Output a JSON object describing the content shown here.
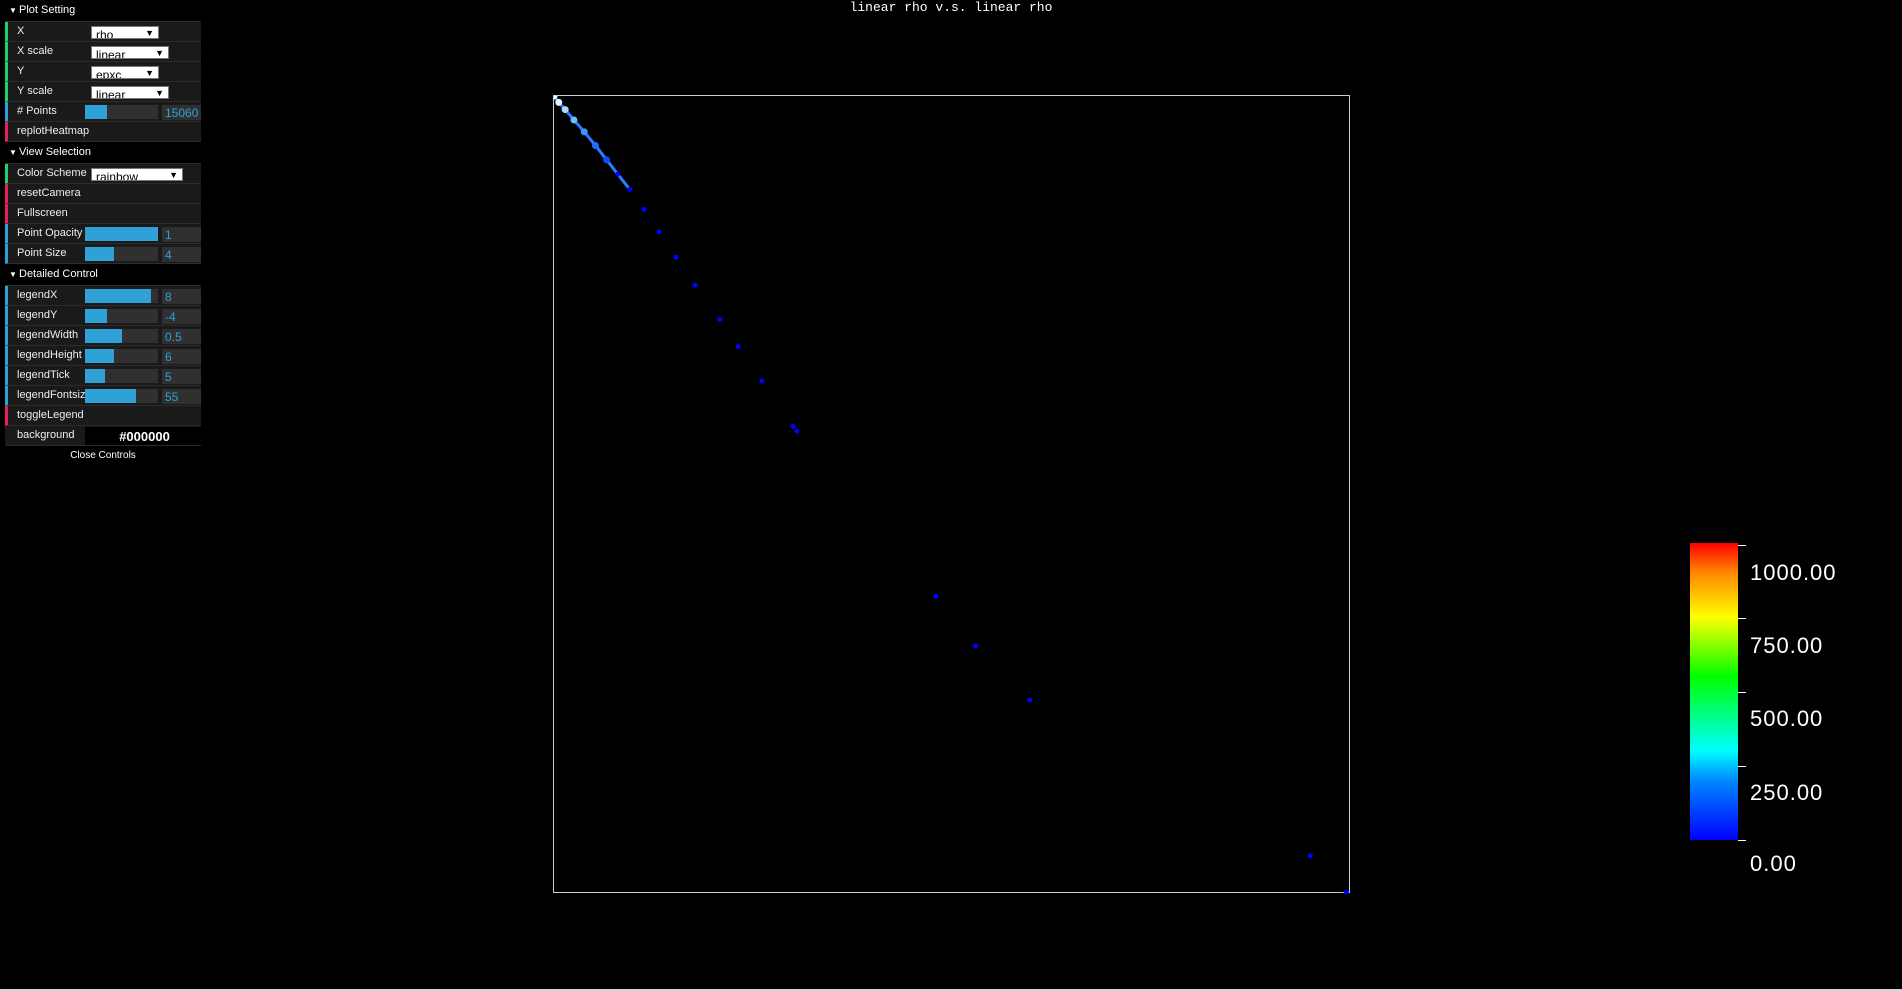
{
  "gui": {
    "plot_setting": {
      "title": "Plot Setting",
      "x_label": "X",
      "x_value": "rho",
      "x_scale_label": "X scale",
      "x_scale_value": "linear",
      "y_label": "Y",
      "y_value": "epxc",
      "y_scale_label": "Y scale",
      "y_scale_value": "linear",
      "points_label": "# Points",
      "points_value": "15060",
      "points_fill": 0.3,
      "replot_label": "replotHeatmap"
    },
    "view_selection": {
      "title": "View Selection",
      "color_scheme_label": "Color Scheme",
      "color_scheme_value": "rainbow",
      "reset_camera_label": "resetCamera",
      "fullscreen_label": "Fullscreen",
      "point_opacity_label": "Point Opacity",
      "point_opacity_value": "1",
      "point_opacity_fill": 1.0,
      "point_size_label": "Point Size",
      "point_size_value": "4",
      "point_size_fill": 0.4
    },
    "detailed_control": {
      "title": "Detailed Control",
      "legendx_label": "legendX",
      "legendx_value": "8",
      "legendx_fill": 0.9,
      "legendy_label": "legendY",
      "legendy_value": "-4",
      "legendy_fill": 0.3,
      "legendwidth_label": "legendWidth",
      "legendwidth_value": "0.5",
      "legendwidth_fill": 0.5,
      "legendheight_label": "legendHeight",
      "legendheight_value": "6",
      "legendheight_fill": 0.4,
      "legendtick_label": "legendTick",
      "legendtick_value": "5",
      "legendtick_fill": 0.28,
      "legendfontsize_label": "legendFontsize",
      "legendfontsize_value": "55",
      "legendfontsize_fill": 0.7,
      "togglelegend_label": "toggleLegend",
      "background_label": "background",
      "background_value": "#000000"
    },
    "close_label": "Close Controls"
  },
  "plot": {
    "title": "linear rho v.s. linear rho"
  },
  "legend": {
    "labels": [
      "1000.00",
      "750.00",
      "500.00",
      "250.00",
      "0.00"
    ]
  },
  "chart_data": {
    "type": "scatter",
    "title": "linear rho v.s. linear rho",
    "xlabel": "",
    "ylabel": "",
    "xlim": [
      0,
      1000
    ],
    "ylim": [
      0,
      1000
    ],
    "grid": false,
    "legend_position": "right",
    "colormap": "rainbow",
    "points": [
      [
        0,
        1000
      ],
      [
        6,
        992
      ],
      [
        14,
        983
      ],
      [
        25,
        970
      ],
      [
        38,
        955
      ],
      [
        52,
        938
      ],
      [
        66,
        920
      ],
      [
        80,
        902
      ],
      [
        95,
        883
      ],
      [
        113,
        858
      ],
      [
        132,
        830
      ],
      [
        153,
        798
      ],
      [
        177,
        763
      ],
      [
        208,
        720
      ],
      [
        231,
        686
      ],
      [
        261,
        643
      ],
      [
        300,
        586
      ],
      [
        305,
        580
      ],
      [
        479,
        373
      ],
      [
        529,
        311
      ],
      [
        597,
        243
      ],
      [
        949,
        48
      ],
      [
        994,
        2
      ]
    ],
    "point_colors": [
      "#ffffff",
      "#e0f4ff",
      "#a9dcff",
      "#6bc0ff",
      "#3d96ff",
      "#1f6cff",
      "#0b4bff",
      "#0000ff",
      "#0000ff",
      "#0000ff",
      "#0000ff",
      "#0000ff",
      "#0000ff",
      "#0000ff",
      "#0000ff",
      "#0000ff",
      "#0000ff",
      "#0000ff",
      "#0000ff",
      "#0000ff",
      "#0000ff",
      "#0000ff",
      "#0000ff"
    ],
    "colorbar": {
      "min": 0,
      "max": 1000,
      "ticks": [
        0,
        250,
        500,
        750,
        1000
      ]
    }
  }
}
